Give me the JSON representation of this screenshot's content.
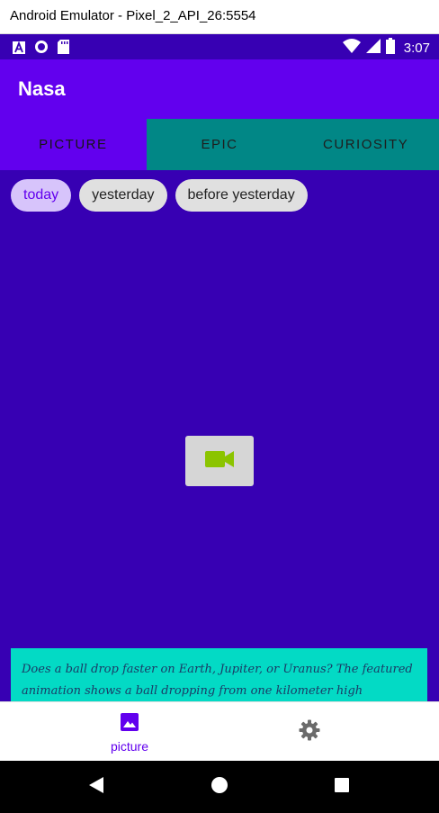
{
  "window": {
    "title": "Android Emulator - Pixel_2_API_26:5554"
  },
  "status_bar": {
    "time": "3:07",
    "left_icons": [
      "app-a-icon",
      "record-icon",
      "sd-card-icon"
    ],
    "right_icons": [
      "wifi-icon",
      "signal-icon",
      "battery-icon"
    ]
  },
  "app_bar": {
    "title": "Nasa"
  },
  "tabs": [
    {
      "label": "PICTURE",
      "active": true
    },
    {
      "label": "EPIC",
      "active": false
    },
    {
      "label": "CURIOSITY",
      "active": false
    }
  ],
  "chips": [
    {
      "label": "today",
      "selected": true
    },
    {
      "label": "yesterday",
      "selected": false
    },
    {
      "label": "before yesterday",
      "selected": false
    }
  ],
  "media": {
    "icon": "videocam-icon"
  },
  "description": {
    "text": "Does a ball drop faster on Earth, Jupiter, or Uranus? The featured animation shows a ball dropping from one kilometer high"
  },
  "bottom_nav": [
    {
      "label": "picture",
      "icon": "image-icon",
      "active": true
    },
    {
      "label": "",
      "icon": "settings-icon",
      "active": false
    }
  ],
  "colors": {
    "status_bar": "#3700b3",
    "app_bar": "#6200ee",
    "tabs_bg": "#018786",
    "content_bg": "#3700b3",
    "description_bg": "#03dac5",
    "accent": "#6200ee"
  }
}
